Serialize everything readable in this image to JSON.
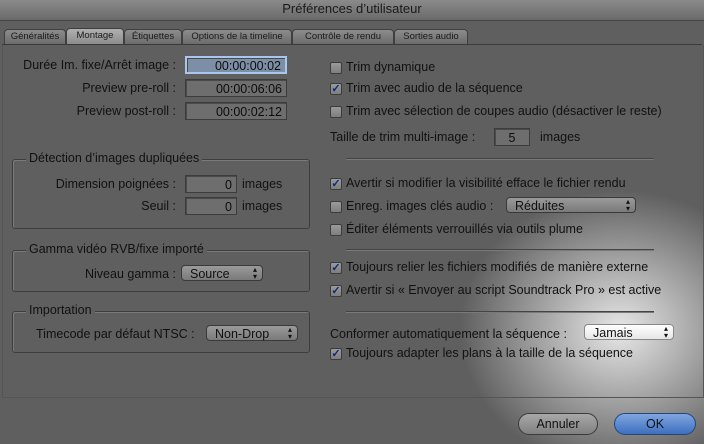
{
  "window": {
    "title": "Préférences d’utilisateur"
  },
  "tabs": [
    "Généralités",
    "Montage",
    "Étiquettes",
    "Options de la timeline",
    "Contrôle de rendu",
    "Sorties audio"
  ],
  "left": {
    "still_duration": {
      "label": "Durée Im. fixe/Arrêt image :",
      "value": "00:00:00:02"
    },
    "preview_preroll": {
      "label": "Preview pre-roll :",
      "value": "00:00:06:06"
    },
    "preview_postroll": {
      "label": "Preview post-roll :",
      "value": "00:00:02:12"
    },
    "dup_group": {
      "title": "Détection d’images dupliquées",
      "handle_label": "Dimension poignées :",
      "handle_value": "0",
      "handle_unit": "images",
      "threshold_label": "Seuil :",
      "threshold_value": "0",
      "threshold_unit": "images"
    },
    "gamma_group": {
      "title": "Gamma vidéo RVB/fixe importé",
      "level_label": "Niveau gamma :",
      "level_value": "Source"
    },
    "import_group": {
      "title": "Importation",
      "tc_label": "Timecode par défaut NTSC :",
      "tc_value": "Non-Drop"
    }
  },
  "right": {
    "dynamic_trim": {
      "label": "Trim dynamique",
      "checked": false
    },
    "trim_audio": {
      "label": "Trim avec audio de la séquence",
      "checked": true
    },
    "trim_selection": {
      "label": "Trim avec sélection de coupes audio (désactiver le reste)",
      "checked": false
    },
    "multi_trim": {
      "label": "Taille de trim multi-image :",
      "value": "5",
      "unit": "images"
    },
    "warn_visibility": {
      "label": "Avertir si modifier la visibilité efface le fichier rendu",
      "checked": true
    },
    "audio_keyframes": {
      "label": "Enreg. images clés audio :",
      "checked": false,
      "value": "Réduites"
    },
    "edit_locked": {
      "label": "Éditer éléments verrouillés via outils plume",
      "checked": false
    },
    "relink": {
      "label": "Toujours relier les fichiers modifiés de manière externe",
      "checked": true
    },
    "warn_soundtrack": {
      "label": "Avertir si « Envoyer au script Soundtrack Pro » est active",
      "checked": true
    },
    "auto_conform": {
      "label": "Conformer automatiquement la séquence :",
      "value": "Jamais"
    },
    "fit_clips": {
      "label": "Toujours adapter les plans à la taille de la séquence",
      "checked": true
    }
  },
  "buttons": {
    "cancel": "Annuler",
    "ok": "OK"
  }
}
